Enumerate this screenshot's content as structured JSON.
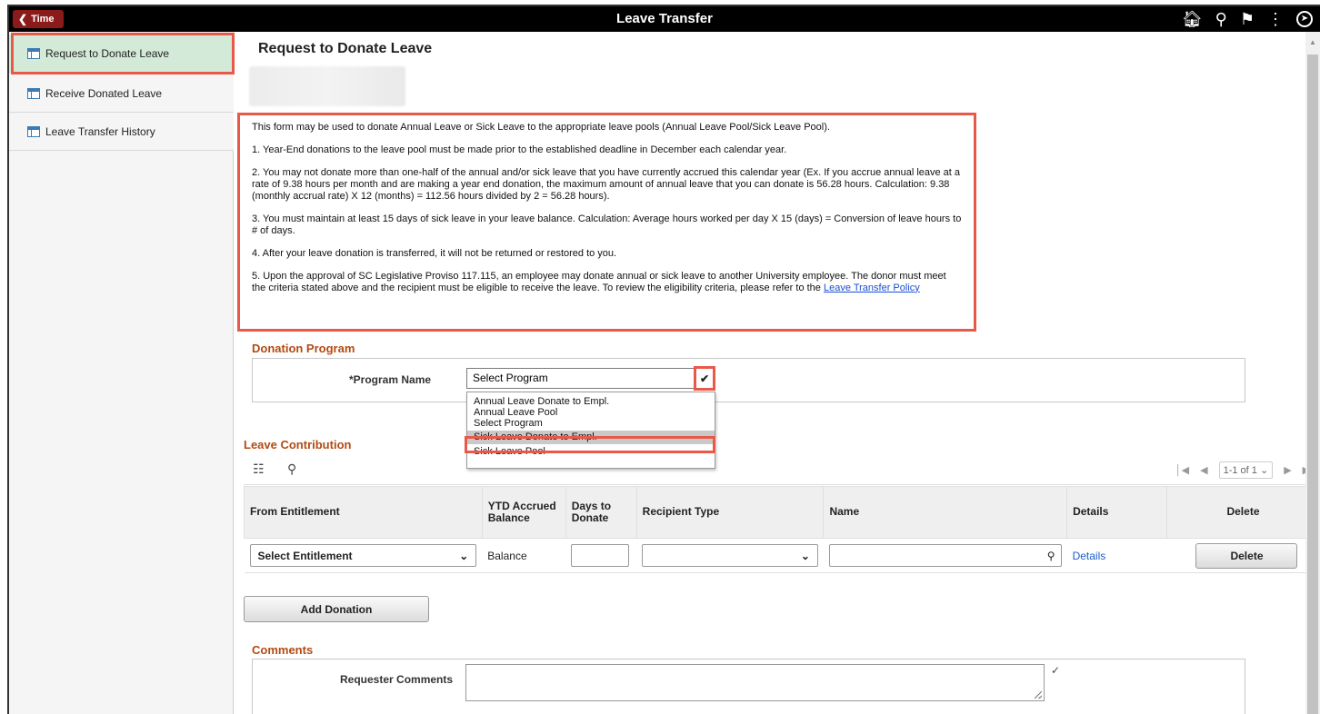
{
  "header": {
    "back_label": "Time",
    "title": "Leave Transfer",
    "icons": [
      "home-icon",
      "search-icon",
      "flag-icon",
      "more-icon",
      "navbar-icon"
    ]
  },
  "sidebar": {
    "items": [
      {
        "label": "Request to Donate Leave",
        "active": true
      },
      {
        "label": "Receive Donated Leave",
        "active": false
      },
      {
        "label": "Leave Transfer History",
        "active": false
      }
    ]
  },
  "main": {
    "page_title": "Request to Donate Leave",
    "info": {
      "intro": "This form may be used to donate Annual Leave or Sick Leave to the appropriate leave pools (Annual Leave Pool/Sick Leave Pool).",
      "item1": "1. Year-End donations to the leave pool must be made prior to the established deadline in December each calendar year.",
      "item2": "2. You may not donate more than one-half of the annual and/or sick leave that you have currently accrued this calendar year (Ex. If you accrue annual leave at a rate of 9.38 hours per month and are making a year end donation, the maximum amount of annual leave that you can donate is 56.28 hours. Calculation: 9.38 (monthly accrual rate) X 12 (months) = 112.56 hours divided by 2 = 56.28 hours).",
      "item3": "3. You must maintain at least 15 days of sick leave in your leave balance. Calculation: Average hours worked per day X 15 (days) = Conversion of leave hours to # of days.",
      "item4": "4. After your leave donation is transferred, it will not be returned or restored to you.",
      "item5": "5. Upon the approval of SC Legislative Proviso 117.115, an employee may donate annual or sick leave to another University employee. The donor must meet the criteria stated above and the recipient must be eligible to receive the leave. To review the eligibility criteria, please refer to the",
      "policy_link": "Leave Transfer Policy"
    },
    "donation_program": {
      "section_title": "Donation Program",
      "program_label": "*Program Name",
      "selected": "Select Program",
      "options": [
        "Annual Leave Donate to Empl.",
        "Annual Leave Pool",
        "Select Program",
        "Sick Leave Donate to Empl.",
        "Sick Leave Pool"
      ],
      "highlighted_option": "Sick Leave Donate to Empl."
    },
    "leave_contribution": {
      "section_title": "Leave Contribution",
      "pager": "1-1 of 1",
      "columns": [
        "From Entitlement",
        "YTD Accrued Balance",
        "Days to Donate",
        "Recipient Type",
        "Name",
        "Details",
        "Delete"
      ],
      "row": {
        "entitlement": "Select Entitlement",
        "balance": "Balance",
        "days": "",
        "recipient_type": "",
        "name": "",
        "details_link": "Details",
        "delete_label": "Delete"
      },
      "add_button": "Add Donation"
    },
    "comments": {
      "section_title": "Comments",
      "requester_label": "Requester Comments",
      "requester_value": ""
    }
  },
  "colors": {
    "highlight_red": "#e8594a",
    "section_title": "#b34a12",
    "back_button": "#8b1a1a",
    "active_item": "#d4ead9"
  }
}
